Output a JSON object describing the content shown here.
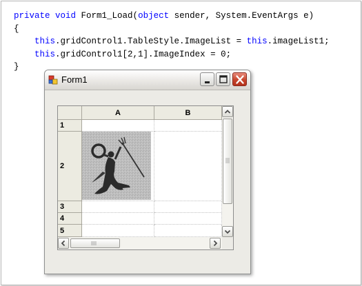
{
  "code": {
    "line1": {
      "kw1": "private",
      "sp1": " ",
      "kw2": "void",
      "mid": " Form1_Load(",
      "kw3": "object",
      "rest": " sender, System.EventArgs e)"
    },
    "line2": "{",
    "line3": {
      "indent": "    ",
      "kw1": "this",
      "mid": ".gridControl1.TableStyle.ImageList = ",
      "kw2": "this",
      "rest": ".imageList1;"
    },
    "line4": {
      "indent": "    ",
      "kw1": "this",
      "rest": ".gridControl1[2,1].ImageIndex = 0;"
    },
    "line5": "}"
  },
  "window": {
    "title": "Form1",
    "buttons": {
      "minimize": "minimize",
      "maximize": "maximize",
      "close": "close"
    }
  },
  "grid": {
    "columns": [
      "A",
      "B"
    ],
    "rows": [
      "1",
      "2",
      "3",
      "4",
      "5"
    ],
    "image_cell": {
      "row": "2",
      "column": "A",
      "image_index": 0
    }
  },
  "colors": {
    "keyword": "#0000ff",
    "close_button": "#c7452d",
    "header_bg": "#ecebe1"
  }
}
